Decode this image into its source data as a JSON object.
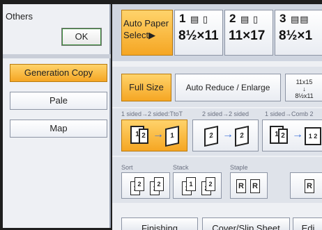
{
  "left_panel": {
    "title": "Others",
    "ok_label": "OK",
    "items": [
      {
        "label": "Generation Copy",
        "selected": true
      },
      {
        "label": "Pale",
        "selected": false
      },
      {
        "label": "Map",
        "selected": false
      }
    ]
  },
  "paper": {
    "auto_paper_line1": "Auto Paper",
    "auto_paper_line2": "Select▶",
    "trays": [
      {
        "number": "1",
        "size": "8½×11"
      },
      {
        "number": "2",
        "size": "11×17"
      },
      {
        "number": "3",
        "size": "8½×1"
      }
    ]
  },
  "reduce": {
    "full_size": "Full Size",
    "auto_reduce": "Auto Reduce / Enlarge",
    "ratio_top": "11x15",
    "ratio_bottom": "8½x11"
  },
  "duplex": {
    "labels": [
      "1 sided→2 sided:TtoT",
      "2 sided→2 sided",
      "1 sided→Comb 2"
    ]
  },
  "sort": {
    "sort_label": "Sort",
    "stack_label": "Stack",
    "staple_label": "Staple"
  },
  "bottom_tabs": {
    "finishing": "Finishing",
    "cover": "Cover/Slip Sheet",
    "edit": "Edi"
  },
  "colors": {
    "selected": "#f5a623",
    "panel": "#eef0f4",
    "arrow": "#3a6fd8"
  }
}
